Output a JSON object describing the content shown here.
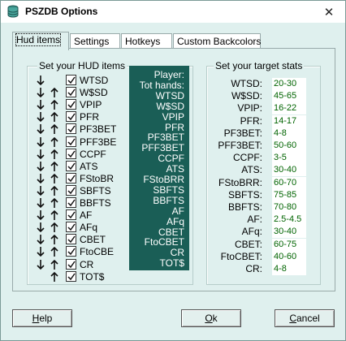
{
  "window": {
    "title": "PSZDB Options",
    "close_label": "✕"
  },
  "tabs": [
    {
      "label": "Hud items",
      "active": true
    },
    {
      "label": "Settings",
      "active": false
    },
    {
      "label": "Hotkeys",
      "active": false
    },
    {
      "label": "Custom Backcolors",
      "active": false
    }
  ],
  "hud_group": {
    "title": "Set your HUD items",
    "items": [
      {
        "label": "WTSD",
        "checked": true
      },
      {
        "label": "W$SD",
        "checked": true
      },
      {
        "label": "VPIP",
        "checked": true
      },
      {
        "label": "PFR",
        "checked": true
      },
      {
        "label": "PF3BET",
        "checked": true
      },
      {
        "label": "PFF3BE",
        "checked": true
      },
      {
        "label": "CCPF",
        "checked": true
      },
      {
        "label": "ATS",
        "checked": true
      },
      {
        "label": "FStoBR",
        "checked": true
      },
      {
        "label": "SBFTS",
        "checked": true
      },
      {
        "label": "BBFTS",
        "checked": true
      },
      {
        "label": "AF",
        "checked": true
      },
      {
        "label": "AFq",
        "checked": true
      },
      {
        "label": "CBET",
        "checked": true
      },
      {
        "label": "FtoCBE",
        "checked": true
      },
      {
        "label": "CR",
        "checked": true
      },
      {
        "label": "TOT$",
        "checked": true
      }
    ]
  },
  "preview": {
    "lines": [
      "Player:",
      "Tot hands:",
      "WTSD",
      "W$SD",
      "VPIP",
      "PFR",
      "PF3BET",
      "PFF3BET",
      "CCPF",
      "ATS",
      "FStoBRR",
      "SBFTS",
      "BBFTS",
      "AF",
      "AFq",
      "CBET",
      "FtoCBET",
      "CR",
      "TOT$"
    ]
  },
  "stats_group": {
    "title": "Set your target stats",
    "stats": [
      {
        "label": "WTSD:",
        "value": "20-30"
      },
      {
        "label": "W$SD:",
        "value": "45-65"
      },
      {
        "label": "VPIP:",
        "value": "16-22"
      },
      {
        "label": "PFR:",
        "value": "14-17"
      },
      {
        "label": "PF3BET:",
        "value": "4-8"
      },
      {
        "label": "PFF3BET:",
        "value": "50-60"
      },
      {
        "label": "CCPF:",
        "value": "3-5"
      },
      {
        "label": "ATS:",
        "value": "30-40"
      },
      {
        "label": "FStoBRR:",
        "value": "60-70"
      },
      {
        "label": "SBFTS:",
        "value": "75-85"
      },
      {
        "label": "BBFTS:",
        "value": "70-80"
      },
      {
        "label": "AF:",
        "value": "2.5-4.5"
      },
      {
        "label": "AFq:",
        "value": "30-40"
      },
      {
        "label": "CBET:",
        "value": "60-75"
      },
      {
        "label": "FtoCBET:",
        "value": "40-60"
      },
      {
        "label": "CR:",
        "value": "4-8"
      }
    ]
  },
  "buttons": {
    "help": {
      "prefix": "",
      "mnemonic": "H",
      "rest": "elp"
    },
    "ok": {
      "prefix": "",
      "mnemonic": "O",
      "rest": "k"
    },
    "cancel": {
      "prefix": "",
      "mnemonic": "C",
      "rest": "ancel"
    }
  },
  "colors": {
    "panel_bg": "#dff0ee",
    "preview_bg": "#1a5e56",
    "value_text": "#006400"
  }
}
